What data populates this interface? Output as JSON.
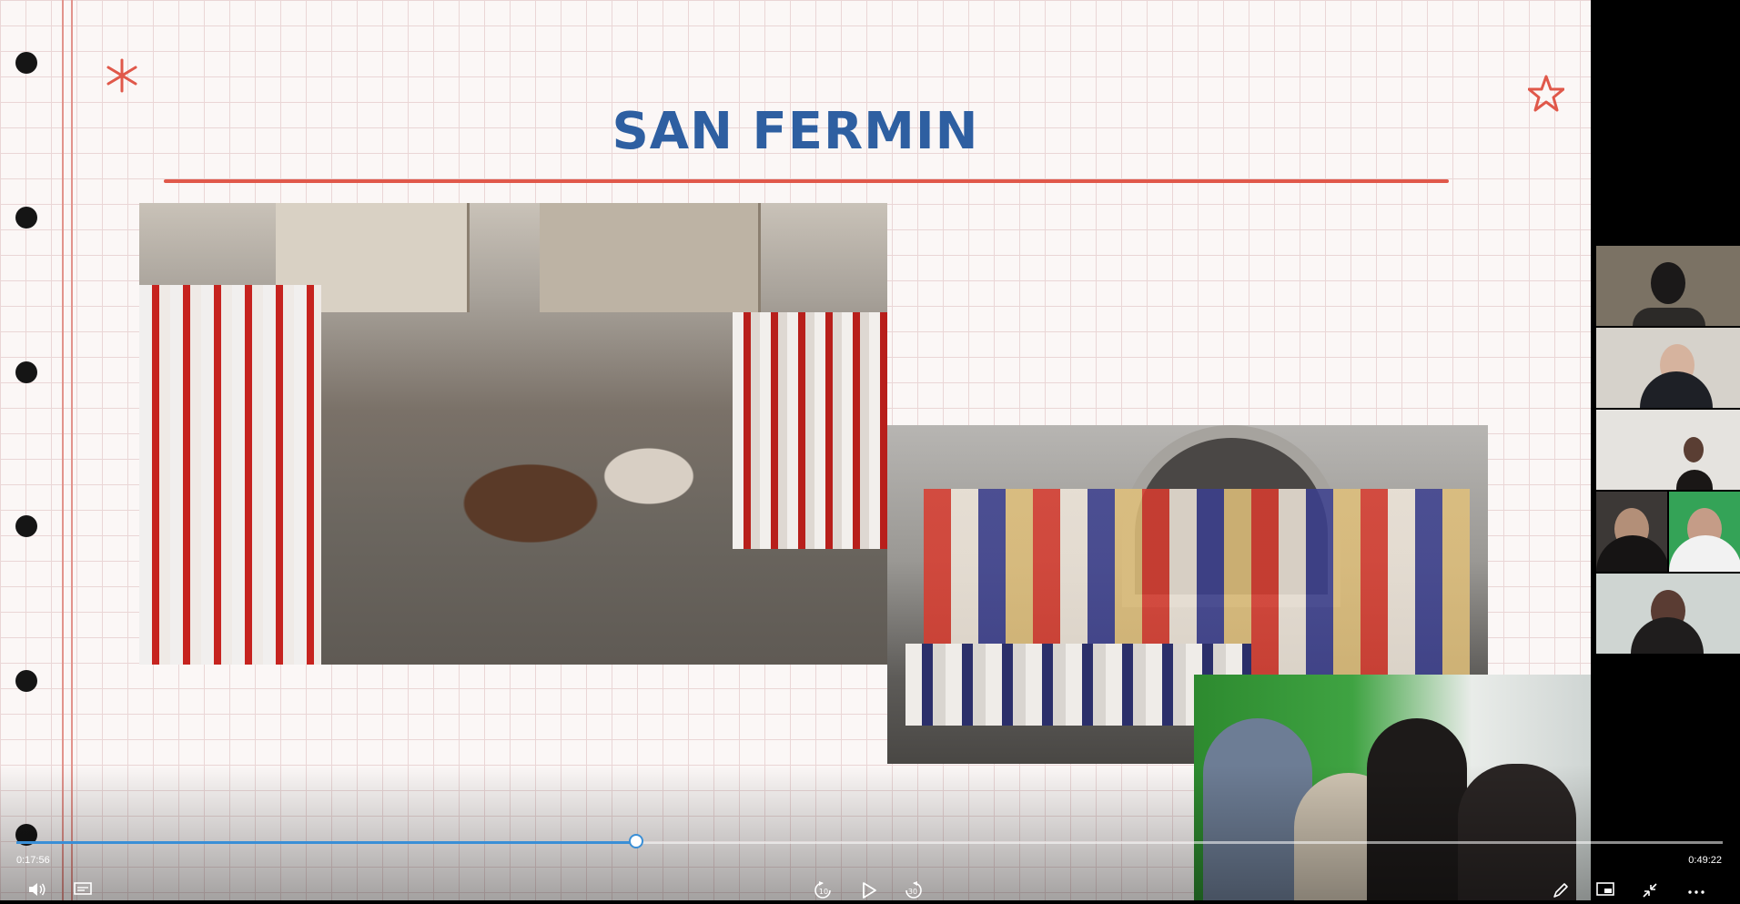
{
  "slide": {
    "title": "SAN FERMIN",
    "photos": [
      {
        "name": "running-of-the-bulls-photo"
      },
      {
        "name": "giants-parade-photo"
      }
    ]
  },
  "player": {
    "current_time": "0:17:56",
    "total_time": "0:49:22",
    "progress": 0.363,
    "accent": "#3a8fd6",
    "controls": [
      {
        "name": "volume-icon"
      },
      {
        "name": "captions-icon"
      },
      {
        "name": "rewind-10-icon",
        "label": "10"
      },
      {
        "name": "play-icon"
      },
      {
        "name": "forward-30-icon",
        "label": "30"
      },
      {
        "name": "pen-icon"
      },
      {
        "name": "picture-in-picture-icon"
      },
      {
        "name": "minimize-icon"
      },
      {
        "name": "more-options-icon"
      }
    ]
  },
  "participants": [
    {
      "name": "participant-1"
    },
    {
      "name": "participant-2"
    },
    {
      "name": "participant-3"
    },
    {
      "name": "participant-4"
    },
    {
      "name": "participant-5"
    },
    {
      "name": "participant-6"
    }
  ],
  "colors": {
    "title": "#2e5fa1",
    "rule": "#e0584a",
    "grid": "#ead6d6"
  }
}
